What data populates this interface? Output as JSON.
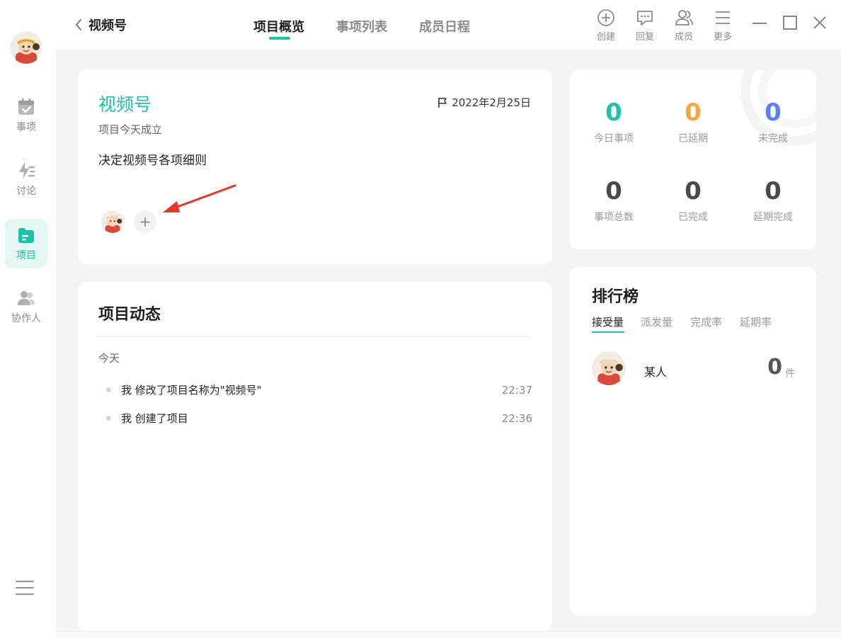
{
  "sidebar": {
    "items": [
      {
        "label": "事项"
      },
      {
        "label": "讨论"
      },
      {
        "label": "项目"
      },
      {
        "label": "协作人"
      }
    ]
  },
  "header": {
    "back_title": "视频号",
    "tabs": [
      {
        "label": "项目概览"
      },
      {
        "label": "事项列表"
      },
      {
        "label": "成员日程"
      }
    ],
    "tools": [
      {
        "label": "创建"
      },
      {
        "label": "回复"
      },
      {
        "label": "成员"
      },
      {
        "label": "更多"
      }
    ]
  },
  "project": {
    "title": "视频号",
    "date": "2022年2月25日",
    "subtitle": "项目今天成立",
    "description": "决定视频号各项细则",
    "add_member_symbol": "+"
  },
  "feed": {
    "title": "项目动态",
    "day_label": "今天",
    "items": [
      {
        "text": "我 修改了项目名称为\"视频号\"",
        "time": "22:37"
      },
      {
        "text": "我 创建了项目",
        "time": "22:36"
      }
    ]
  },
  "stats": [
    {
      "value": "0",
      "label": "今日事项",
      "color": "#1cc3a6"
    },
    {
      "value": "0",
      "label": "已延期",
      "color": "#f5a742"
    },
    {
      "value": "0",
      "label": "未完成",
      "color": "#5b7ff5"
    },
    {
      "value": "0",
      "label": "事项总数",
      "color": "#4a4a4a"
    },
    {
      "value": "0",
      "label": "已完成",
      "color": "#4a4a4a"
    },
    {
      "value": "0",
      "label": "延期完成",
      "color": "#4a4a4a"
    }
  ],
  "ranking": {
    "title": "排行榜",
    "tabs": [
      {
        "label": "接受量"
      },
      {
        "label": "派发量"
      },
      {
        "label": "完成率"
      },
      {
        "label": "延期率"
      }
    ],
    "entries": [
      {
        "name": "某人",
        "count": "0",
        "unit": "件"
      }
    ]
  },
  "colors": {
    "accent": "#1cc3a6",
    "warning": "#f5a742",
    "info": "#5b7ff5"
  }
}
